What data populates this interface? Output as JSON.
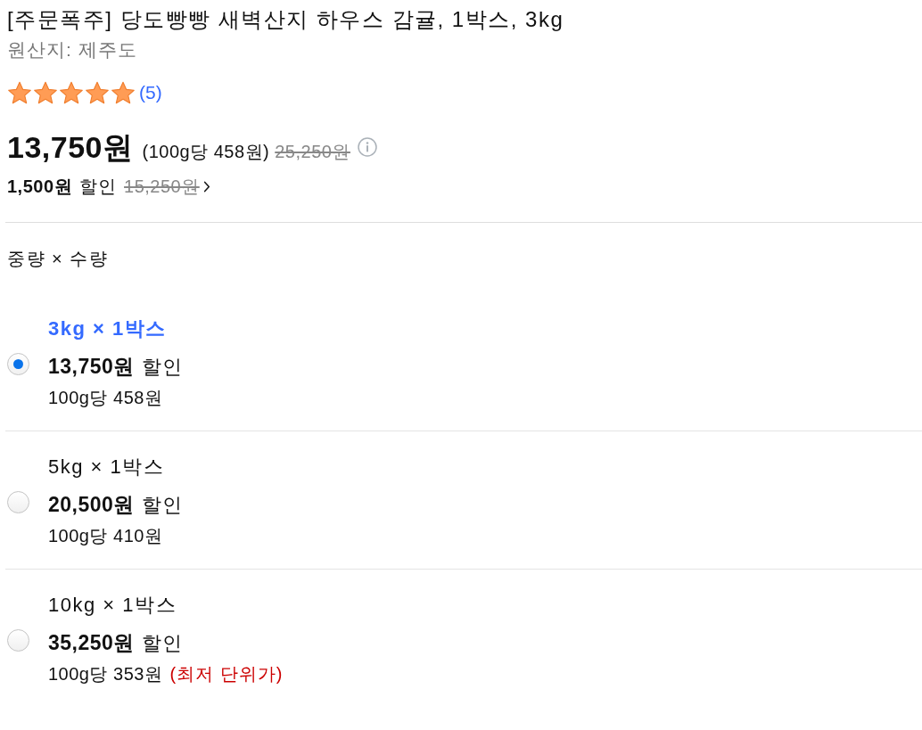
{
  "product": {
    "title": "[주문폭주] 당도빵빵 새벽산지 하우스 감귤, 1박스, 3kg",
    "origin": "원산지: 제주도",
    "rating": {
      "stars": 5,
      "count": "(5)"
    }
  },
  "price": {
    "amount": "13,750원",
    "unit_price": "(100g당 458원)",
    "original": "25,250원"
  },
  "discount": {
    "amount": "1,500원",
    "label": "할인",
    "original": "15,250원"
  },
  "options_section": {
    "heading": "중량 × 수량",
    "options": [
      {
        "label": "3kg × 1박스",
        "selected": true,
        "price": "13,750원",
        "price_note": "할인",
        "unit_price": "100g당 458원"
      },
      {
        "label": "5kg × 1박스",
        "selected": false,
        "price": "20,500원",
        "price_note": "할인",
        "unit_price": "100g당 410원"
      },
      {
        "label": "10kg × 1박스",
        "selected": false,
        "price": "35,250원",
        "price_note": "할인",
        "unit_price": "100g당 353원",
        "badge": "(최저 단위가)"
      }
    ]
  }
}
